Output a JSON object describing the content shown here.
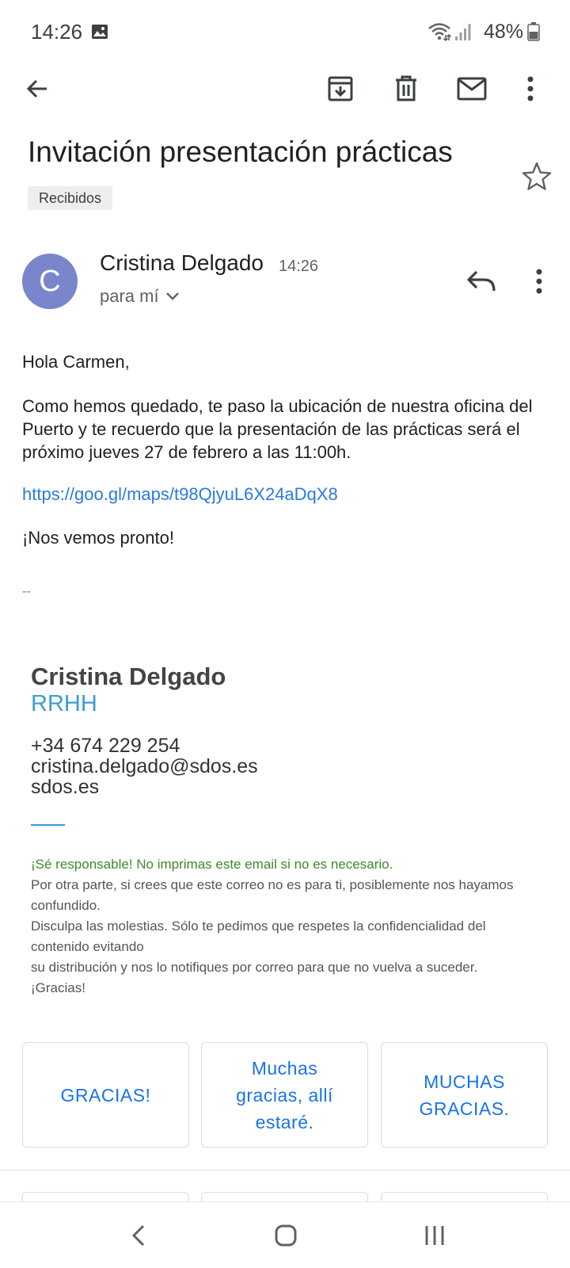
{
  "status_bar": {
    "time": "14:26",
    "battery": "48%"
  },
  "toolbar": {
    "icons": [
      "back-arrow-icon",
      "archive-icon",
      "delete-icon",
      "mark-unread-icon",
      "more-vert-icon"
    ]
  },
  "email": {
    "subject": "Invitación presentación prácticas",
    "label": "Recibidos",
    "sender": {
      "initial": "C",
      "name": "Cristina Delgado",
      "time": "14:26",
      "to": "para mí",
      "avatar_color": "#7986cb"
    },
    "body": {
      "greeting": "Hola Carmen,",
      "paragraph": "Como hemos quedado, te paso la ubicación de nuestra oficina del Puerto y te recuerdo que la presentación de las prácticas será el próximo jueves 27 de febrero a las 11:00h.",
      "link": "https://goo.gl/maps/t98QjyuL6X24aDqX8",
      "closing": "¡Nos vemos pronto!",
      "sig_separator": "--"
    },
    "signature": {
      "name": "Cristina Delgado",
      "role": "RRHH",
      "phone": "+34 674 229 254",
      "email": "cristina.delgado@sdos.es",
      "website": "sdos.es",
      "accent_color": "#3d9bd6"
    },
    "disclaimer": {
      "green": "¡Sé responsable! No imprimas este email si no es necesario.",
      "line1": "Por otra parte, si crees que este correo no es para ti, posiblemente nos hayamos confundido.",
      "line2": "Disculpa las molestias. Sólo te pedimos que respetes la confidencialidad del contenido evitando",
      "line3": "su distribución y nos lo notifiques por correo para que no vuelva a suceder.",
      "line4": "¡Gracias!"
    }
  },
  "smart_replies": [
    "GRACIAS!",
    "Muchas gracias, allí estaré.",
    "MUCHAS GRACIAS."
  ],
  "nav_bar": {
    "icons": [
      "nav-back-icon",
      "nav-home-icon",
      "nav-recents-icon"
    ]
  }
}
